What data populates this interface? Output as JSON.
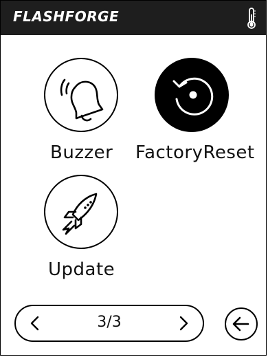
{
  "header": {
    "brand": "FLASHFORGE",
    "status_icon": "thermometer-icon"
  },
  "tiles": [
    {
      "label": "Buzzer",
      "icon": "bell-ringing-icon",
      "style": "outline"
    },
    {
      "label": "FactoryReset",
      "icon": "reset-icon",
      "style": "filled"
    },
    {
      "label": "Update",
      "icon": "rocket-icon",
      "style": "outline"
    }
  ],
  "pager": {
    "text": "3/3",
    "prev_icon": "chevron-left-icon",
    "next_icon": "chevron-right-icon"
  },
  "back": {
    "icon": "arrow-left-icon"
  },
  "colors": {
    "header_bg": "#1e1e1e",
    "header_text": "#ffffff",
    "ink": "#000000",
    "background": "#ffffff"
  }
}
